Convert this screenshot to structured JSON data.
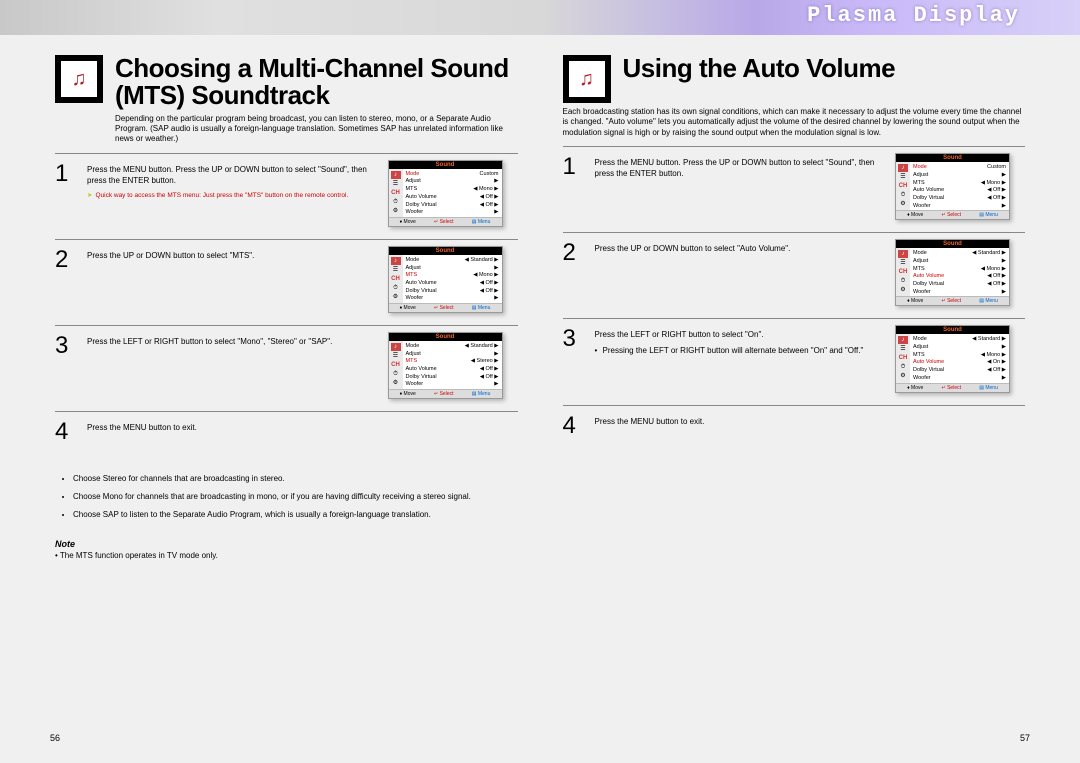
{
  "banner_title": "Plasma Display",
  "left": {
    "heading": "Choosing a Multi-Channel Sound (MTS) Soundtrack",
    "intro": "Depending on the particular program being broadcast, you can listen to stereo, mono, or a Separate Audio Program. (SAP audio is usually a foreign-language translation. Sometimes SAP has unrelated information like news or weather.)",
    "steps": [
      {
        "num": "1",
        "body": "Press the MENU button. Press the UP or DOWN button to select \"Sound\", then press the ENTER button.",
        "tip": "Quick way to access the MTS menu: Just press the \"MTS\" button on the remote control.",
        "screen": {
          "title": "Sound",
          "rows": [
            {
              "label": "Mode",
              "value": "Custom",
              "sel": true
            },
            {
              "label": "Adjust",
              "value": "▶"
            },
            {
              "label": "MTS",
              "value": "◀ Mono ▶"
            },
            {
              "label": "Auto Volume",
              "value": "◀ Off ▶"
            },
            {
              "label": "Dolby Virtual",
              "value": "◀ Off ▶"
            },
            {
              "label": "Woofer",
              "value": "▶"
            }
          ]
        }
      },
      {
        "num": "2",
        "body": "Press the UP or DOWN button to select \"MTS\".",
        "screen": {
          "title": "Sound",
          "rows": [
            {
              "label": "Mode",
              "value": "◀ Standard ▶"
            },
            {
              "label": "Adjust",
              "value": "▶"
            },
            {
              "label": "MTS",
              "value": "◀ Mono ▶",
              "sel": true
            },
            {
              "label": "Auto Volume",
              "value": "◀ Off ▶"
            },
            {
              "label": "Dolby Virtual",
              "value": "◀ Off ▶"
            },
            {
              "label": "Woofer",
              "value": "▶"
            }
          ]
        }
      },
      {
        "num": "3",
        "body": "Press the LEFT or RIGHT button to select \"Mono\", \"Stereo\" or \"SAP\".",
        "screen": {
          "title": "Sound",
          "rows": [
            {
              "label": "Mode",
              "value": "◀ Standard ▶"
            },
            {
              "label": "Adjust",
              "value": "▶"
            },
            {
              "label": "MTS",
              "value": "◀ Stereo ▶",
              "sel": true
            },
            {
              "label": "Auto Volume",
              "value": "◀ Off ▶"
            },
            {
              "label": "Dolby Virtual",
              "value": "◀ Off ▶"
            },
            {
              "label": "Woofer",
              "value": "▶"
            }
          ]
        }
      },
      {
        "num": "4",
        "body": "Press the MENU button to exit."
      }
    ],
    "bullets": [
      "Choose Stereo for channels that are broadcasting in stereo.",
      "Choose Mono for channels that are broadcasting in mono, or if you are having difficulty receiving a stereo signal.",
      "Choose SAP to listen to the Separate Audio Program, which is usually a foreign-language translation."
    ],
    "note_label": "Note",
    "note_text": "• The MTS function operates in TV mode only.",
    "page": "56"
  },
  "right": {
    "heading": "Using the Auto Volume",
    "intro": "Each broadcasting station has its own signal conditions, which can make it necessary to adjust the volume every time the channel is changed. \"Auto volume\" lets you automatically adjust the volume of the desired channel by lowering the sound output when the modulation signal is high or by raising the sound output when the modulation signal is low.",
    "steps": [
      {
        "num": "1",
        "body": "Press the MENU button. Press the UP or DOWN button to select \"Sound\", then press the ENTER button.",
        "screen": {
          "title": "Sound",
          "rows": [
            {
              "label": "Mode",
              "value": "Custom",
              "sel": true
            },
            {
              "label": "Adjust",
              "value": "▶"
            },
            {
              "label": "MTS",
              "value": "◀ Mono ▶"
            },
            {
              "label": "Auto Volume",
              "value": "◀ Off ▶"
            },
            {
              "label": "Dolby Virtual",
              "value": "◀ Off ▶"
            },
            {
              "label": "Woofer",
              "value": "▶"
            }
          ]
        }
      },
      {
        "num": "2",
        "body": "Press the UP or DOWN button to select \"Auto Volume\".",
        "screen": {
          "title": "Sound",
          "rows": [
            {
              "label": "Mode",
              "value": "◀ Standard ▶"
            },
            {
              "label": "Adjust",
              "value": "▶"
            },
            {
              "label": "MTS",
              "value": "◀ Mono ▶"
            },
            {
              "label": "Auto Volume",
              "value": "◀ Off ▶",
              "sel": true
            },
            {
              "label": "Dolby Virtual",
              "value": "◀ Off ▶"
            },
            {
              "label": "Woofer",
              "value": "▶"
            }
          ]
        }
      },
      {
        "num": "3",
        "body": "Press the LEFT or RIGHT button to select \"On\".",
        "subnote": "Pressing the LEFT or RIGHT button will alternate between \"On\" and \"Off.\"",
        "screen": {
          "title": "Sound",
          "rows": [
            {
              "label": "Mode",
              "value": "◀ Standard ▶"
            },
            {
              "label": "Adjust",
              "value": "▶"
            },
            {
              "label": "MTS",
              "value": "◀ Mono ▶"
            },
            {
              "label": "Auto Volume",
              "value": "◀ On ▶",
              "sel": true
            },
            {
              "label": "Dolby Virtual",
              "value": "◀ Off ▶"
            },
            {
              "label": "Woofer",
              "value": "▶"
            }
          ]
        }
      },
      {
        "num": "4",
        "body": "Press the MENU button to exit."
      }
    ],
    "page": "57"
  },
  "screen_footer": {
    "move": "♦ Move",
    "select": "↵ Select",
    "menu": "▤ Menu"
  }
}
